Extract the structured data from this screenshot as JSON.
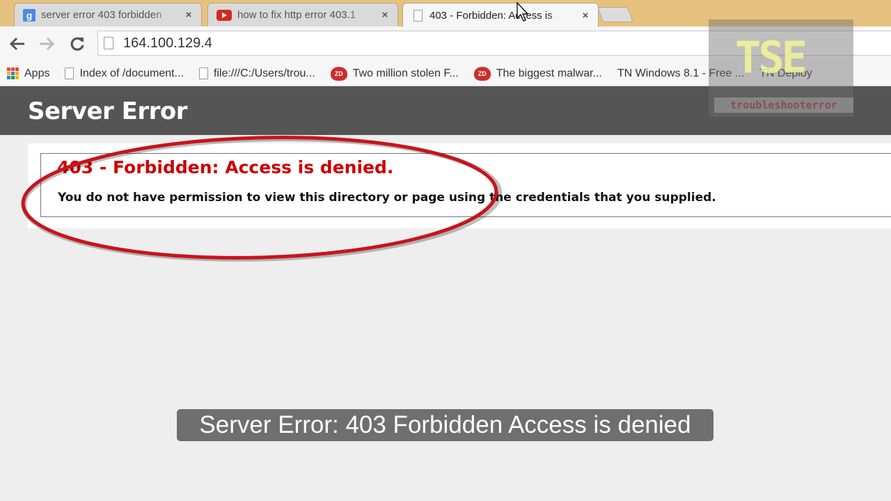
{
  "browser": {
    "tabs": [
      {
        "title": "server error 403 forbidden",
        "favicon": "google-icon",
        "favicon_text": "g",
        "active": false
      },
      {
        "title": "how to fix http error 403.1",
        "favicon": "youtube-icon",
        "active": false
      },
      {
        "title": "403 - Forbidden: Access is",
        "favicon": "page-icon",
        "active": true
      }
    ],
    "close_glyph": "×",
    "address": "164.100.129.4",
    "bookmarks": [
      {
        "label": "Apps",
        "icon": "apps-icon"
      },
      {
        "label": "Index of /document...",
        "icon": "page-icon"
      },
      {
        "label": "file:///C:/Users/trou...",
        "icon": "page-icon"
      },
      {
        "label": "Two million stolen F...",
        "icon": "zdnet-icon",
        "icon_text": "ZD"
      },
      {
        "label": "The biggest malwar...",
        "icon": "zdnet-icon",
        "icon_text": "ZD"
      },
      {
        "label": "TN Windows 8.1 - Free ...",
        "icon": "none"
      },
      {
        "label": "TN Deploy",
        "icon": "none"
      }
    ]
  },
  "page": {
    "header_title": "Server Error",
    "error_title": "403 - Forbidden: Access is denied.",
    "error_description": "You do not have permission to view this directory or page using the credentials that you supplied."
  },
  "watermark": {
    "logo_text": "TSE",
    "site_text": "troubleshooterror"
  },
  "caption": "Server Error: 403 Forbidden Access is denied",
  "colors": {
    "tabstrip_bg": "#e7c27e",
    "header_bg": "#555555",
    "error_red": "#cc0000",
    "annotation_red": "#c8141c",
    "caption_bg": "#6f6f6f"
  }
}
